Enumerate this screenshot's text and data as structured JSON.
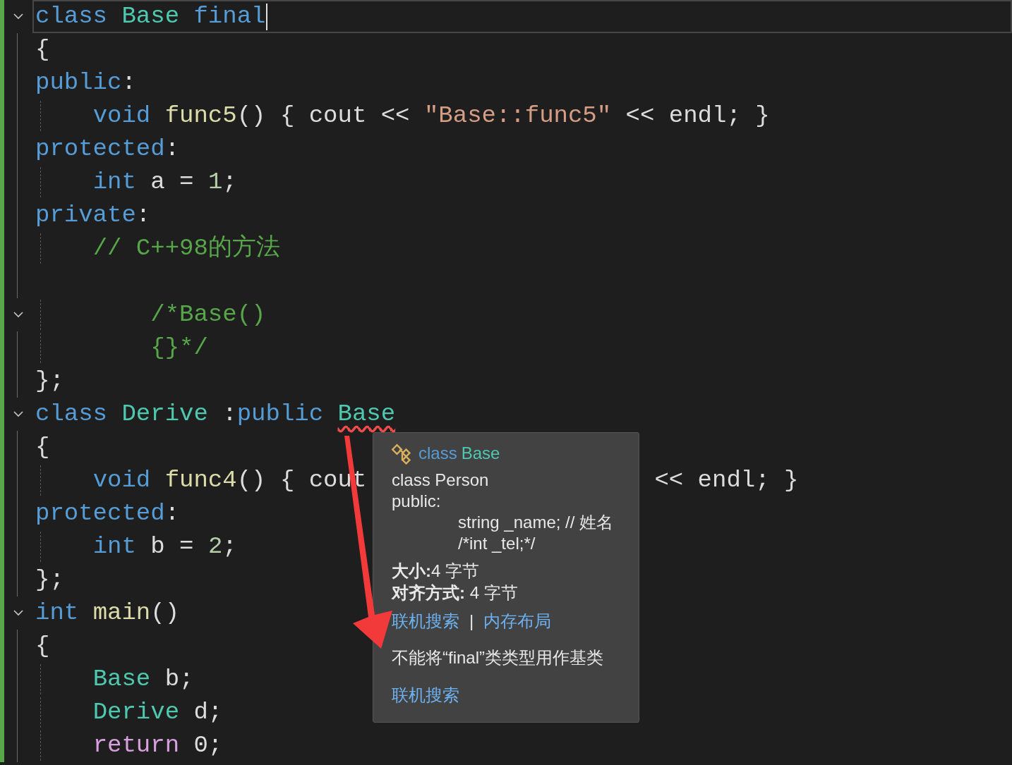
{
  "editor": {
    "lines": [
      {
        "foldable": true,
        "current": true,
        "tokens": [
          {
            "text": "class",
            "kind": "keyword"
          },
          {
            "text": " Base",
            "kind": "type"
          },
          {
            "text": " final",
            "kind": "keyword"
          }
        ]
      },
      {
        "foldable": false,
        "current": false,
        "tokens": [
          {
            "text": "{",
            "kind": "plain"
          }
        ]
      },
      {
        "foldable": false,
        "current": false,
        "tokens": [
          {
            "text": "public",
            "kind": "keyword"
          },
          {
            "text": ":",
            "kind": "plain"
          }
        ]
      },
      {
        "foldable": false,
        "current": false,
        "tokens": [
          {
            "text": "    void",
            "kind": "keyword"
          },
          {
            "text": " func5",
            "kind": "function"
          },
          {
            "text": "() { cout << ",
            "kind": "plain"
          },
          {
            "text": "\"Base::func5\"",
            "kind": "string"
          },
          {
            "text": " << endl; }",
            "kind": "plain"
          }
        ]
      },
      {
        "foldable": false,
        "current": false,
        "tokens": [
          {
            "text": "protected",
            "kind": "keyword"
          },
          {
            "text": ":",
            "kind": "plain"
          }
        ]
      },
      {
        "foldable": false,
        "current": false,
        "tokens": [
          {
            "text": "    int",
            "kind": "keyword"
          },
          {
            "text": " a = ",
            "kind": "plain"
          },
          {
            "text": "1",
            "kind": "number"
          },
          {
            "text": ";",
            "kind": "plain"
          }
        ]
      },
      {
        "foldable": false,
        "current": false,
        "tokens": [
          {
            "text": "private",
            "kind": "keyword"
          },
          {
            "text": ":",
            "kind": "plain"
          }
        ]
      },
      {
        "foldable": false,
        "current": false,
        "tokens": [
          {
            "text": "    // C++98的方法",
            "kind": "comment"
          }
        ]
      },
      {
        "foldable": false,
        "current": false
      },
      {
        "foldable": true,
        "current": false,
        "tokens": [
          {
            "text": "        /*Base()",
            "kind": "comment"
          }
        ]
      },
      {
        "foldable": false,
        "current": false,
        "tokens": [
          {
            "text": "        {}*/",
            "kind": "comment"
          }
        ]
      },
      {
        "foldable": false,
        "current": false,
        "tokens": [
          {
            "text": "};",
            "kind": "plain"
          }
        ]
      },
      {
        "foldable": true,
        "current": false,
        "tokens": [
          {
            "text": "class",
            "kind": "keyword"
          },
          {
            "text": " Derive",
            "kind": "type"
          },
          {
            "text": " :",
            "kind": "plain"
          },
          {
            "text": "public ",
            "kind": "keyword"
          },
          {
            "text": "Base",
            "kind": "type",
            "error": true
          }
        ]
      },
      {
        "foldable": false,
        "current": false,
        "tokens": [
          {
            "text": "{",
            "kind": "plain"
          }
        ]
      },
      {
        "foldable": false,
        "current": false,
        "tokens": [
          {
            "text": "    void",
            "kind": "keyword"
          },
          {
            "text": " func4",
            "kind": "function"
          },
          {
            "text": "() { cout",
            "kind": "plain"
          },
          {
            "text": "                    << endl; }",
            "kind": "plain"
          }
        ]
      },
      {
        "foldable": false,
        "current": false,
        "tokens": [
          {
            "text": "protected",
            "kind": "keyword"
          },
          {
            "text": ":",
            "kind": "plain"
          }
        ]
      },
      {
        "foldable": false,
        "current": false,
        "tokens": [
          {
            "text": "    int",
            "kind": "keyword"
          },
          {
            "text": " b = ",
            "kind": "plain"
          },
          {
            "text": "2",
            "kind": "number"
          },
          {
            "text": ";",
            "kind": "plain"
          }
        ]
      },
      {
        "foldable": false,
        "current": false,
        "tokens": [
          {
            "text": "};",
            "kind": "plain"
          }
        ]
      },
      {
        "foldable": true,
        "current": false,
        "tokens": [
          {
            "text": "int",
            "kind": "keyword"
          },
          {
            "text": " main",
            "kind": "function"
          },
          {
            "text": "()",
            "kind": "plain"
          }
        ]
      },
      {
        "foldable": false,
        "current": false,
        "tokens": [
          {
            "text": "{",
            "kind": "plain"
          }
        ]
      },
      {
        "foldable": false,
        "current": false,
        "tokens": [
          {
            "text": "    Base",
            "kind": "type"
          },
          {
            "text": " b;",
            "kind": "plain"
          }
        ]
      },
      {
        "foldable": false,
        "current": false,
        "tokens": [
          {
            "text": "    Derive",
            "kind": "type"
          },
          {
            "text": " d;",
            "kind": "plain"
          }
        ]
      },
      {
        "foldable": false,
        "current": false,
        "tokens": [
          {
            "text": "    return",
            "kind": "control"
          },
          {
            "text": " 0;",
            "kind": "plain"
          }
        ]
      }
    ]
  },
  "tooltip": {
    "symbol": {
      "keyword": "class",
      "name": "Base"
    },
    "declaration": [
      {
        "text": "class Person",
        "kind": "line"
      },
      {
        "text": "public:",
        "kind": "line"
      },
      {
        "text": "string _name; // 姓名",
        "kind": "member"
      },
      {
        "text": "/*int _tel;*/",
        "kind": "member"
      }
    ],
    "facts": [
      "**大小:**4 字节",
      "**对齐方式:** 4 字节"
    ],
    "links": [
      "联机搜索",
      "内存布局"
    ],
    "link_separator": "|",
    "error": "不能将“final”类类型用作基类",
    "help_link": "联机搜索"
  }
}
